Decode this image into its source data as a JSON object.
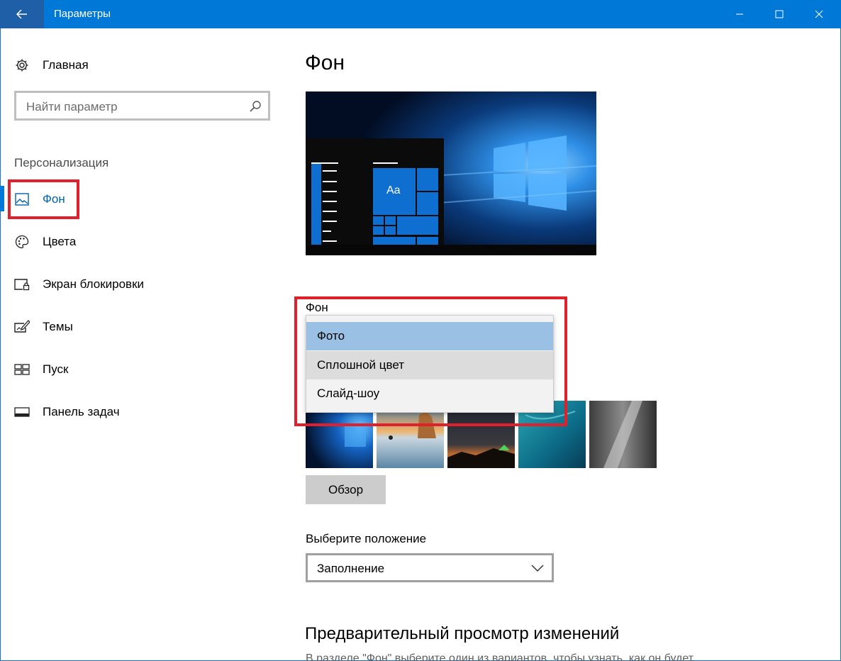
{
  "window": {
    "title": "Параметры"
  },
  "sidebar": {
    "home_label": "Главная",
    "search_placeholder": "Найти параметр",
    "section_title": "Персонализация",
    "items": [
      {
        "label": "Фон",
        "icon": "picture-icon",
        "active": true
      },
      {
        "label": "Цвета",
        "icon": "palette-icon"
      },
      {
        "label": "Экран блокировки",
        "icon": "lock-screen-icon"
      },
      {
        "label": "Темы",
        "icon": "themes-icon"
      },
      {
        "label": "Пуск",
        "icon": "start-icon"
      },
      {
        "label": "Панель задач",
        "icon": "taskbar-icon"
      }
    ]
  },
  "main": {
    "title": "Фон",
    "preview_tile_text": "Aa",
    "background_label": "Фон",
    "background_options": [
      "Фото",
      "Сплошной цвет",
      "Слайд-шоу"
    ],
    "background_selected": "Фото",
    "browse_label": "Обзор",
    "position_label": "Выберите положение",
    "position_value": "Заполнение",
    "preview_heading": "Предварительный просмотр изменений",
    "preview_description": "В разделе \"Фон\" выберите один из вариантов, чтобы узнать, как он будет"
  },
  "colors": {
    "accent": "#0078d7",
    "highlight_border": "#e0202a",
    "selected_option": "#9ac1e4"
  }
}
